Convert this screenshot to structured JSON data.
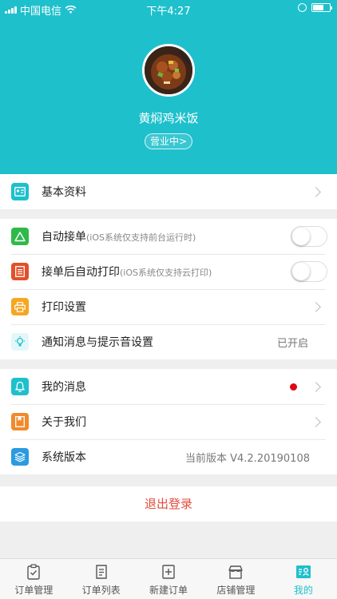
{
  "status_bar": {
    "carrier": "中国电信",
    "time": "下午4:27"
  },
  "profile": {
    "shop_name": "黄焖鸡米饭",
    "status": "营业中>"
  },
  "sections": {
    "basic": {
      "label": "基本资料"
    },
    "auto_accept": {
      "label": "自动接单",
      "note": "(iOS系统仅支持前台运行时)"
    },
    "auto_print": {
      "label": "接单后自动打印",
      "note": "(iOS系统仅支持云打印)"
    },
    "print_settings": {
      "label": "打印设置"
    },
    "notifications": {
      "label": "通知消息与提示音设置",
      "value": "已开启"
    },
    "messages": {
      "label": "我的消息"
    },
    "about": {
      "label": "关于我们"
    },
    "version": {
      "label": "系统版本",
      "value": "当前版本 V4.2.20190108"
    }
  },
  "logout_label": "退出登录",
  "tabs": [
    {
      "label": "订单管理",
      "icon": "clipboard-icon"
    },
    {
      "label": "订单列表",
      "icon": "list-icon"
    },
    {
      "label": "新建订单",
      "icon": "add-order-icon"
    },
    {
      "label": "店铺管理",
      "icon": "store-icon"
    },
    {
      "label": "我的",
      "icon": "profile-icon"
    }
  ],
  "colors": {
    "accent": "#1ec0cc",
    "logout": "#e44b3b",
    "badge": "#e60012",
    "icon_basic": "#1ec0cc",
    "icon_accept": "#2fb94a",
    "icon_print_auto": "#e2502a",
    "icon_print": "#f5a623",
    "icon_notify": "#1ec0cc",
    "icon_message": "#1ec0cc",
    "icon_about": "#f08a2c",
    "icon_version": "#2b9be0"
  }
}
